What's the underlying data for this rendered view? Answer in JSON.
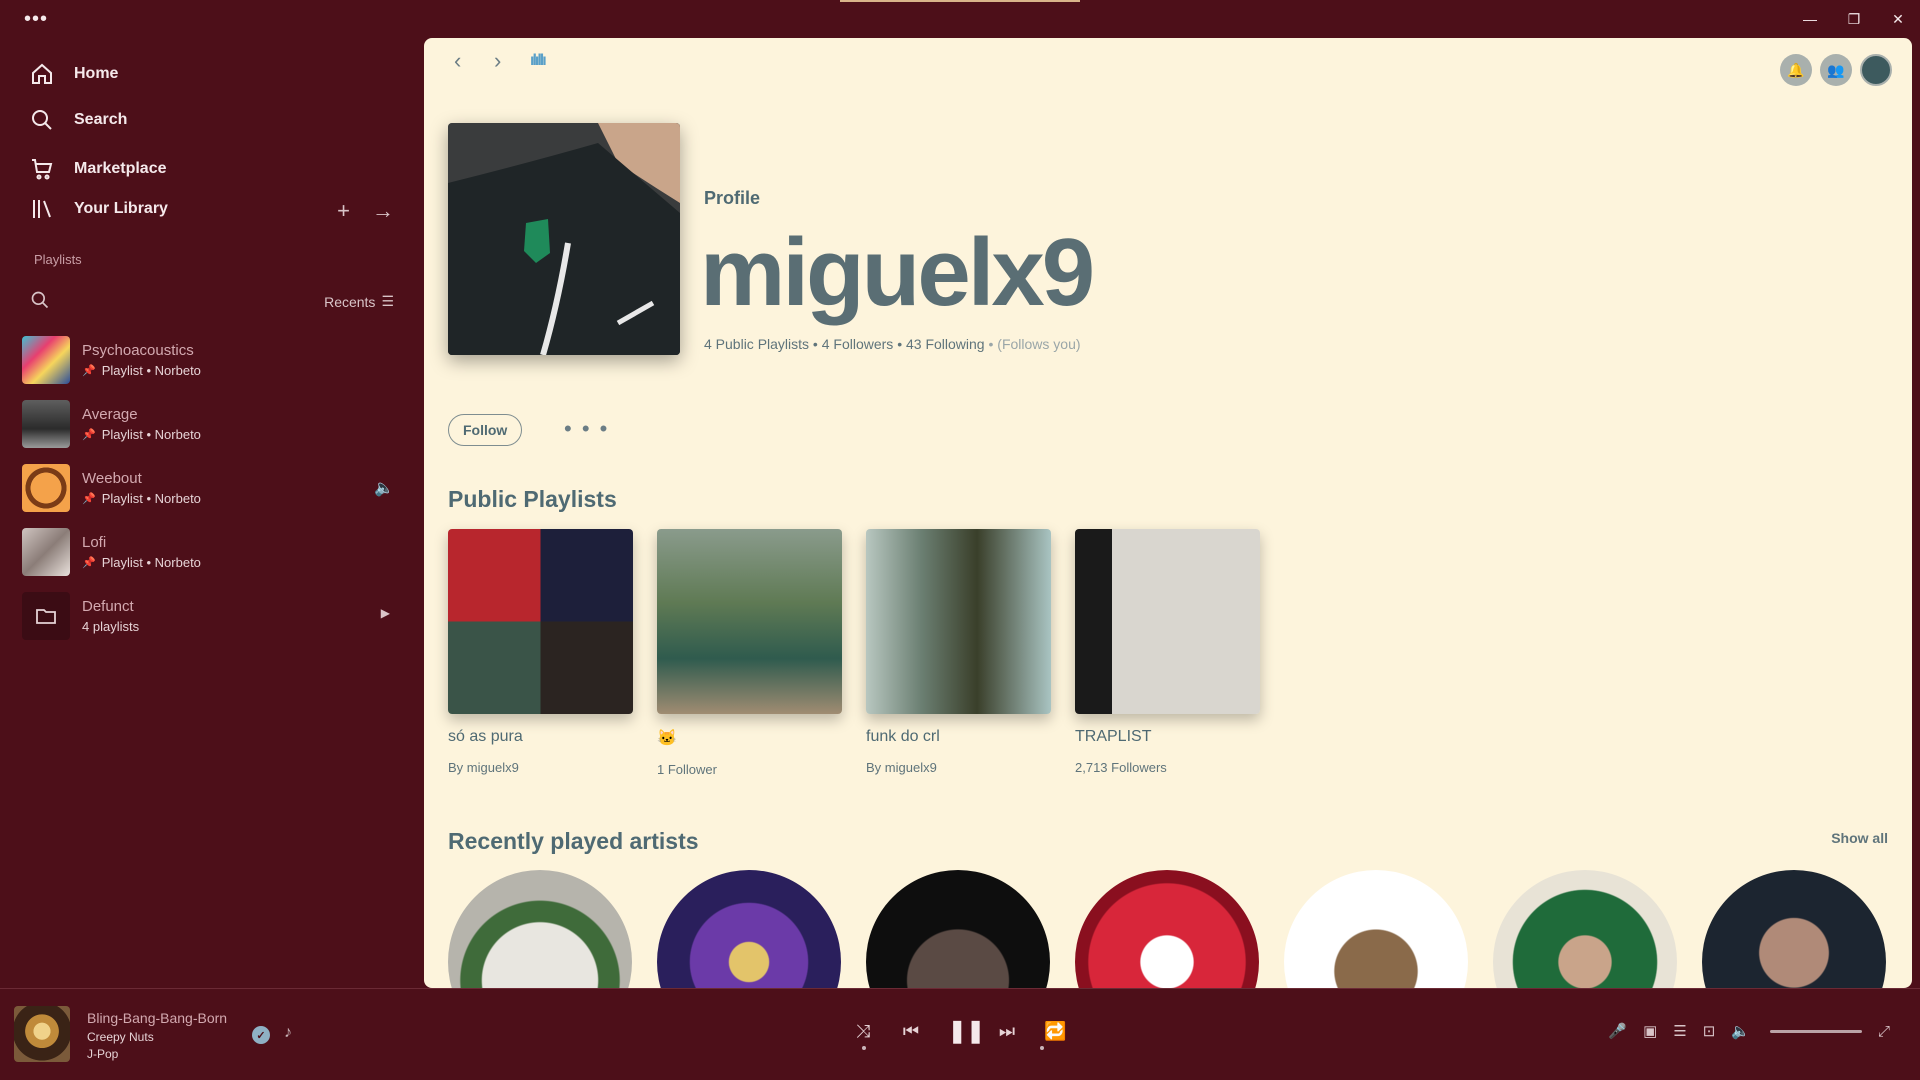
{
  "titlebar": {
    "menu_icon": "more-horizontal-icon",
    "minimize": "—",
    "restore": "❐",
    "close": "✕"
  },
  "sidebar": {
    "nav": [
      {
        "label": "Home",
        "icon": "home-icon"
      },
      {
        "label": "Search",
        "icon": "search-icon"
      },
      {
        "label": "Marketplace",
        "icon": "cart-icon"
      },
      {
        "label": "Your Library",
        "icon": "library-icon"
      }
    ],
    "add_symbol": "+",
    "expand_symbol": "→",
    "filter_label": "Playlists",
    "sort_label": "Recents",
    "items": [
      {
        "title": "Psychoacoustics",
        "subtitle": "Playlist • Norbeto",
        "pinned": true
      },
      {
        "title": "Average",
        "subtitle": "Playlist • Norbeto",
        "pinned": true
      },
      {
        "title": "Weebout",
        "subtitle": "Playlist • Norbeto",
        "pinned": true,
        "playing": true
      },
      {
        "title": "Lofi",
        "subtitle": "Playlist • Norbeto",
        "pinned": true
      },
      {
        "title": "Defunct",
        "subtitle": "4 playlists",
        "folder": true
      }
    ]
  },
  "main": {
    "back": "‹",
    "forward": "›",
    "wave": "ılıllı",
    "profile": {
      "type_label": "Profile",
      "name": "miguelx9",
      "stats": "4 Public Playlists • 4 Followers • 43 Following",
      "follows_you": "• (Follows you)"
    },
    "follow_label": "Follow",
    "more_label": "• • •",
    "public_playlists_title": "Public Playlists",
    "playlists": [
      {
        "title": "só as pura",
        "subtitle": "By miguelx9"
      },
      {
        "title": "🐱",
        "subtitle": "1 Follower"
      },
      {
        "title": "funk do crl",
        "subtitle": "By miguelx9"
      },
      {
        "title": "TRAPLIST",
        "subtitle": "2,713 Followers"
      }
    ],
    "recent_artists_title": "Recently played artists",
    "show_all": "Show all"
  },
  "player": {
    "title": "Bling-Bang-Bang-Born",
    "artist": "Creepy Nuts",
    "genre": "J-Pop",
    "check": "✓",
    "note": "♪",
    "shuffle": "⤨",
    "prev": "⏮",
    "pause": "❚❚",
    "next": "⏭",
    "repeat": "🔁",
    "volume_level": 0.95
  },
  "colors": {
    "sidebar_bg": "#4d0f19",
    "main_bg": "#fdf4dc",
    "accent_text": "#4f6a73"
  }
}
